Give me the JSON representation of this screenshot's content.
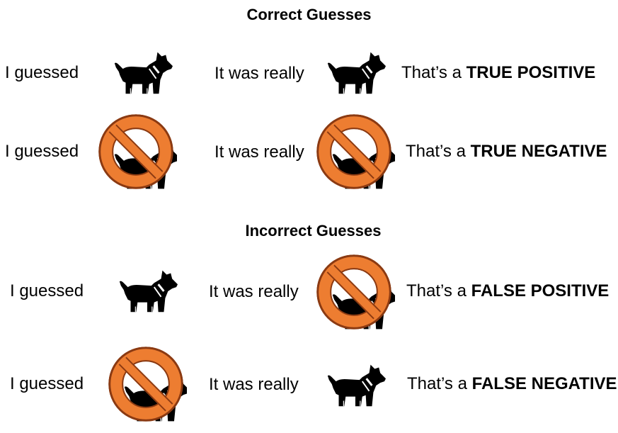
{
  "sections": [
    {
      "title": "Correct Guesses",
      "rows": [
        {
          "guess_label": "I guessed",
          "guess_icon": "dog-icon",
          "actual_label": "It was really",
          "actual_icon": "dog-icon",
          "result_prefix": "That’s a",
          "result_term": "TRUE POSITIVE"
        },
        {
          "guess_label": "I guessed",
          "guess_icon": "no-dog-icon",
          "actual_label": "It was really",
          "actual_icon": "no-dog-icon",
          "result_prefix": "That’s a",
          "result_term": "TRUE NEGATIVE"
        }
      ]
    },
    {
      "title": "Incorrect Guesses",
      "rows": [
        {
          "guess_label": "I guessed",
          "guess_icon": "dog-icon",
          "actual_label": "It was really",
          "actual_icon": "no-dog-icon",
          "result_prefix": "That’s a",
          "result_term": "FALSE POSITIVE"
        },
        {
          "guess_label": "I guessed",
          "guess_icon": "no-dog-icon",
          "actual_label": "It was really",
          "actual_icon": "dog-icon",
          "result_prefix": "That’s a",
          "result_term": "FALSE NEGATIVE"
        }
      ]
    }
  ],
  "colors": {
    "prohibit_fill": "#ED7D31",
    "prohibit_stroke": "#8B3A12",
    "dog": "#000000"
  }
}
